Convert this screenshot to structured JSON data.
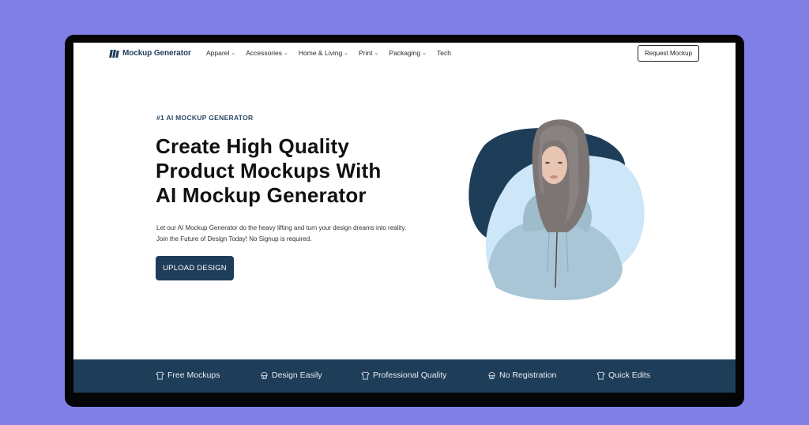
{
  "brand": {
    "name": "Mockup Generator",
    "logo_icon": "logo-bars-icon",
    "brand_color": "#1e3d5a",
    "background_color": "#7f7fe6"
  },
  "nav": {
    "items": [
      {
        "label": "Apparel",
        "has_dropdown": true
      },
      {
        "label": "Accessories",
        "has_dropdown": true
      },
      {
        "label": "Home & Living",
        "has_dropdown": true
      },
      {
        "label": "Print",
        "has_dropdown": true
      },
      {
        "label": "Packaging",
        "has_dropdown": true
      },
      {
        "label": "Tech",
        "has_dropdown": false
      }
    ],
    "chevron": "⌄",
    "cta_label": "Request Mockup"
  },
  "hero": {
    "eyebrow": "#1 AI MOCKUP GENERATOR",
    "headline_lines": [
      "Create High Quality",
      "Product Mockups With",
      "AI Mockup Generator"
    ],
    "description_lines": [
      "Let our AI Mockup Generator do the heavy lifting and turn your design dreams into reality.",
      "Join the Future of Design Today! No Signup is required."
    ],
    "button_label": "UPLOAD DESIGN",
    "image_alt": "Woman wearing light blue hoodie"
  },
  "features": [
    {
      "label": "Free Mockups",
      "icon": "tshirt-icon"
    },
    {
      "label": "Design Easily",
      "icon": "cupcake-icon"
    },
    {
      "label": "Professional Quality",
      "icon": "tshirt-icon"
    },
    {
      "label": "No Registration",
      "icon": "cupcake-icon"
    },
    {
      "label": "Quick Edits",
      "icon": "tshirt-icon"
    }
  ]
}
